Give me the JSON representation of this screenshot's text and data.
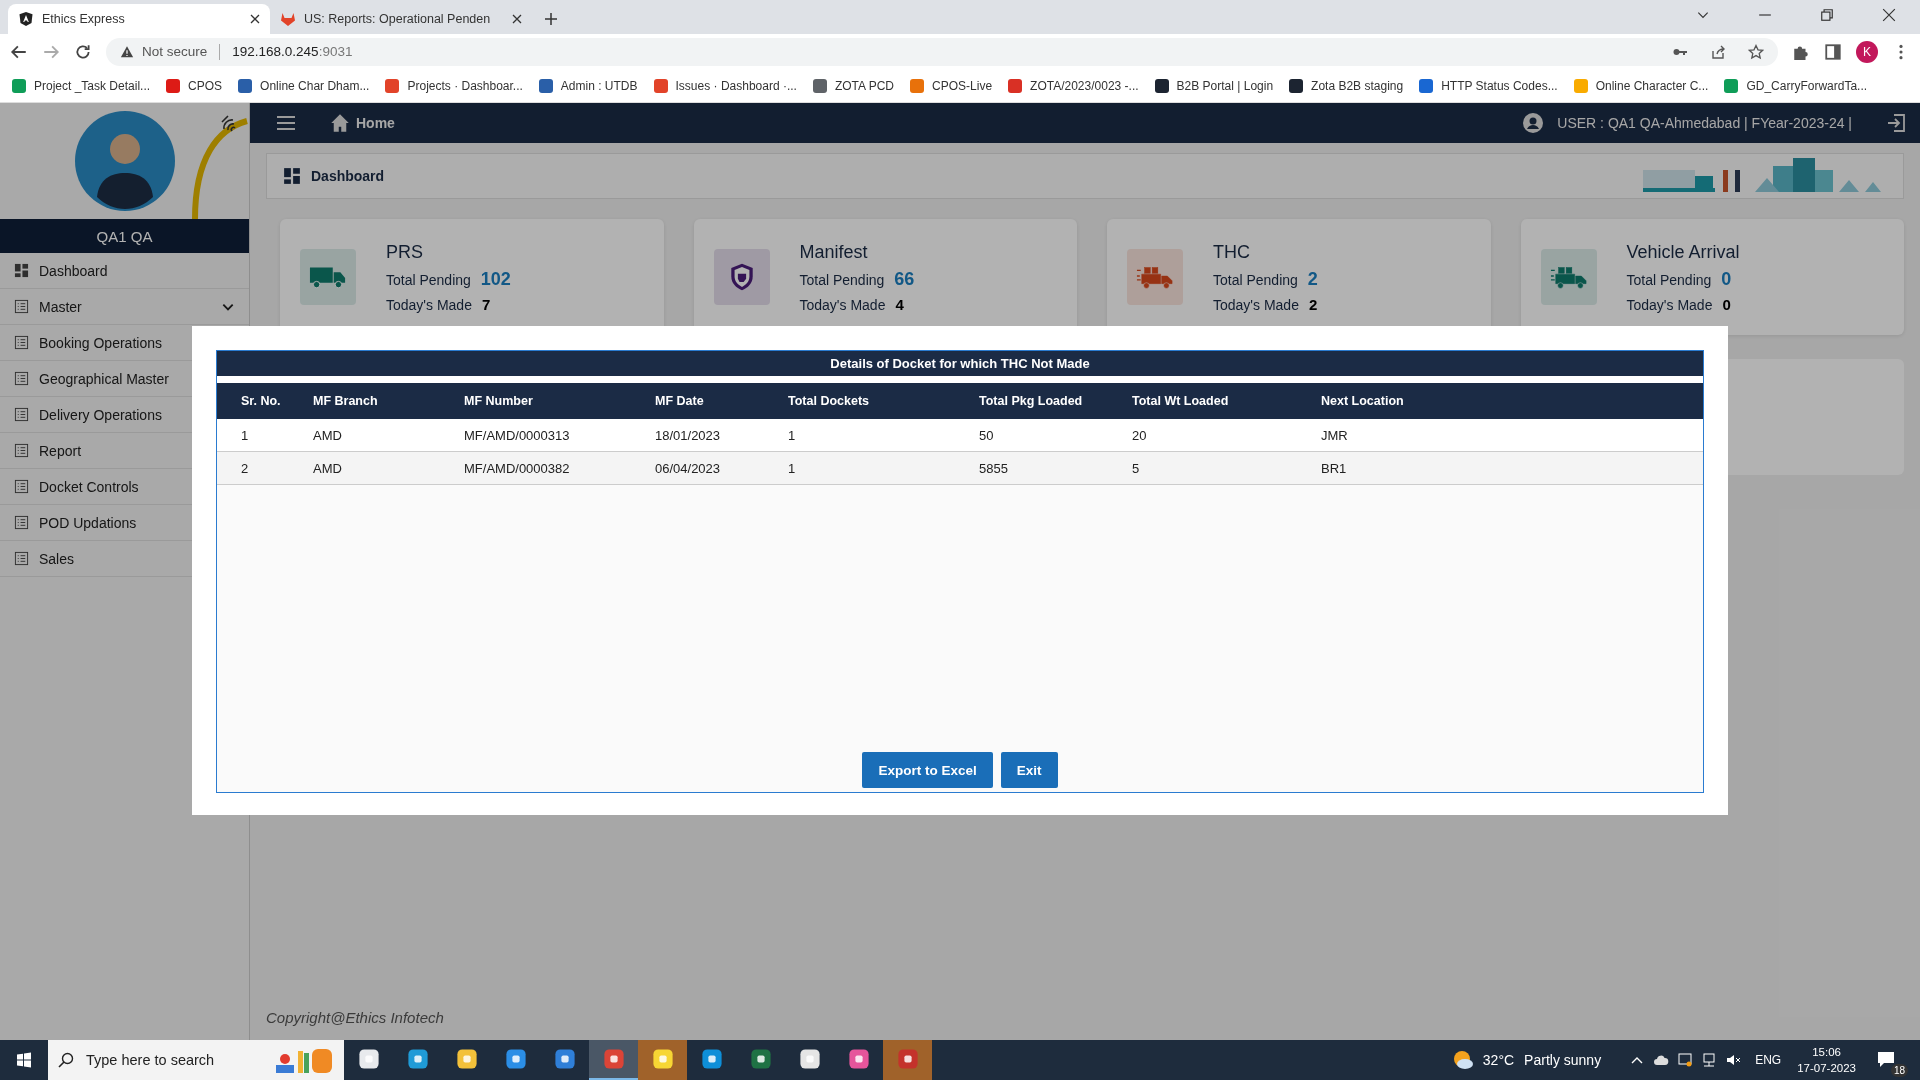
{
  "browser": {
    "tabs": [
      {
        "title": "Ethics Express",
        "selected": true,
        "kind": "angular"
      },
      {
        "title": "US: Reports: Operational Penden",
        "selected": false,
        "kind": "gitlab"
      }
    ],
    "address": {
      "warning": "Not secure",
      "host": "192.168.0.245",
      "port": ":9031"
    },
    "profile": "K",
    "bookmarks": [
      {
        "label": "Project _Task Detail...",
        "color": "#0f9d58"
      },
      {
        "label": "CPOS",
        "color": "#dd1b16"
      },
      {
        "label": "Online Char Dham...",
        "color": "#2a5fa8"
      },
      {
        "label": "Projects · Dashboar...",
        "color": "#e24329"
      },
      {
        "label": "Admin : UTDB",
        "color": "#2a5fa8"
      },
      {
        "label": "Issues · Dashboard ·...",
        "color": "#e24329"
      },
      {
        "label": "ZOTA PCD",
        "color": "#5f6368"
      },
      {
        "label": "CPOS-Live",
        "color": "#e8710a"
      },
      {
        "label": "ZOTA/2023/0023 -...",
        "color": "#d93025"
      },
      {
        "label": "B2B Portal | Login",
        "color": "#1c2431"
      },
      {
        "label": "Zota B2B staging",
        "color": "#1c2431"
      },
      {
        "label": "HTTP Status Codes...",
        "color": "#1967d2"
      },
      {
        "label": "Online Character C...",
        "color": "#f9ab00"
      },
      {
        "label": "GD_CarryForwardTa...",
        "color": "#0f9d58"
      }
    ]
  },
  "sidebar": {
    "user_name": "QA1 QA",
    "items": [
      {
        "label": "Dashboard",
        "kind": "grid",
        "expandable": false
      },
      {
        "label": "Master",
        "kind": "list",
        "expandable": true
      },
      {
        "label": "Booking Operations",
        "kind": "list"
      },
      {
        "label": "Geographical Master",
        "kind": "list"
      },
      {
        "label": "Delivery Operations",
        "kind": "list"
      },
      {
        "label": "Report",
        "kind": "list"
      },
      {
        "label": "Docket Controls",
        "kind": "list"
      },
      {
        "label": "POD Updations",
        "kind": "list"
      },
      {
        "label": "Sales",
        "kind": "list"
      }
    ]
  },
  "header": {
    "home": "Home",
    "user": "USER : QA1 QA-Ahmedabad | FYear-2023-24 |"
  },
  "breadcrumb": "Dashboard",
  "cards": [
    {
      "title": "PRS",
      "pending_label": "Total Pending",
      "pending": "102",
      "made_label": "Today's Made",
      "made": "7",
      "kind": "truck"
    },
    {
      "title": "Manifest",
      "pending_label": "Total Pending",
      "pending": "66",
      "made_label": "Today's Made",
      "made": "4",
      "kind": "shield"
    },
    {
      "title": "THC",
      "pending_label": "Total Pending",
      "pending": "2",
      "made_label": "Today's Made",
      "made": "2",
      "kind": "cargo-truck"
    },
    {
      "title": "Vehicle Arrival",
      "pending_label": "Total Pending",
      "pending": "0",
      "made_label": "Today's Made",
      "made": "0",
      "kind": "arrival-truck"
    }
  ],
  "modal": {
    "title": "Details of Docket for which THC Not Made",
    "columns": [
      "Sr. No.",
      "MF Branch",
      "MF Number",
      "MF Date",
      "Total Dockets",
      "Total Pkg Loaded",
      "Total Wt Loaded",
      "Next Location"
    ],
    "rows": [
      [
        "1",
        "AMD",
        "MF/AMD/0000313",
        "18/01/2023",
        "1",
        "50",
        "20",
        "JMR"
      ],
      [
        "2",
        "AMD",
        "MF/AMD/0000382",
        "06/04/2023",
        "1",
        "5855",
        "5",
        "BR1"
      ]
    ],
    "buttons": [
      "Export to Excel",
      "Exit"
    ]
  },
  "footer": "Copyright@Ethics Infotech",
  "taskbar": {
    "search_placeholder": "Type here to search",
    "apps": [
      {
        "kind": "taskview",
        "selected": false,
        "flashing": false
      },
      {
        "kind": "edge",
        "selected": false,
        "flashing": false
      },
      {
        "kind": "folder",
        "selected": false,
        "flashing": false
      },
      {
        "kind": "mail",
        "selected": false,
        "flashing": false
      },
      {
        "kind": "store",
        "selected": false,
        "flashing": false
      },
      {
        "kind": "chrome",
        "selected": true,
        "flashing": false
      },
      {
        "kind": "notes",
        "selected": false,
        "flashing": true
      },
      {
        "kind": "skype",
        "selected": false,
        "flashing": false
      },
      {
        "kind": "excel",
        "selected": false,
        "flashing": false
      },
      {
        "kind": "snip",
        "selected": false,
        "flashing": false
      },
      {
        "kind": "paint",
        "selected": false,
        "flashing": false
      },
      {
        "kind": "tool",
        "selected": false,
        "flashing": true
      }
    ],
    "temperature": "32°C",
    "weather": "Partly sunny",
    "language": "ENG",
    "time": "15:06",
    "date": "17-07-2023",
    "notifications": "18"
  }
}
